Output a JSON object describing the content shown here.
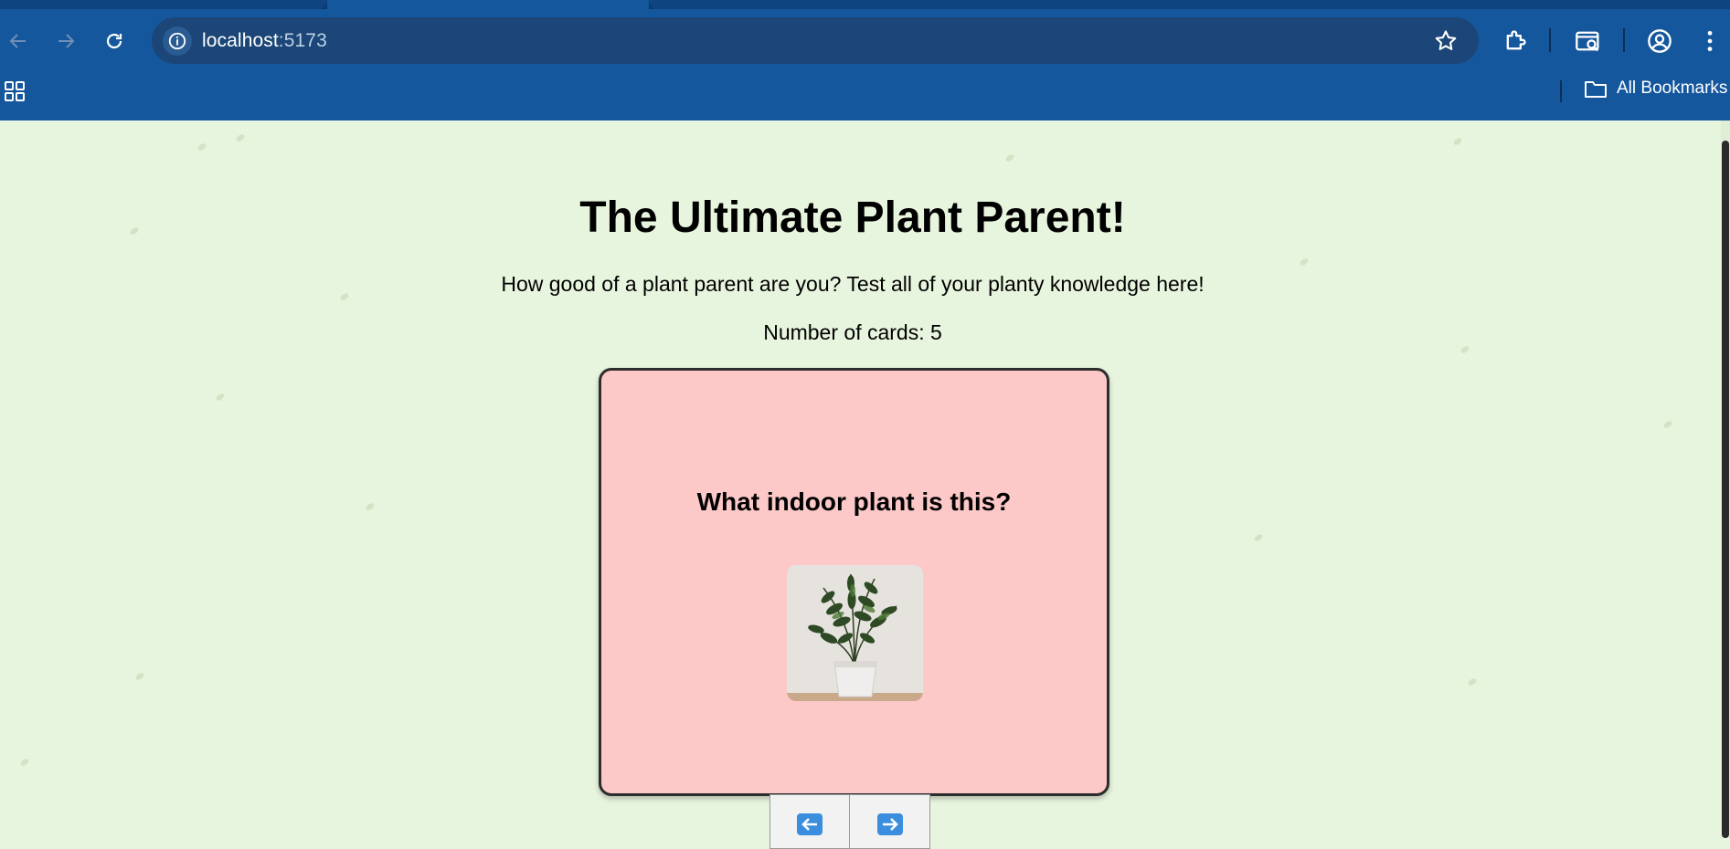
{
  "browser": {
    "url_host": "localhost",
    "url_port": ":5173",
    "bookmarks_label": "All Bookmarks",
    "icons": {
      "back": "arrow-left-icon",
      "forward": "arrow-right-icon",
      "reload": "reload-icon",
      "site_info": "info-icon",
      "bookmark_star": "star-icon",
      "extensions": "puzzle-icon",
      "tab_search": "tab-search-icon",
      "profile": "profile-icon",
      "menu": "kebab-menu-icon",
      "apps": "apps-grid-icon",
      "folder": "folder-icon"
    },
    "colors": {
      "chrome": "#15579d",
      "omnibox": "#1b4677"
    }
  },
  "page": {
    "title": "The Ultimate Plant Parent!",
    "subtitle": "How good of a plant parent are you? Test all of your planty knowledge here!",
    "card_count": "Number of cards: 5",
    "background": "#e8f5de"
  },
  "card": {
    "question": "What indoor plant is this?",
    "background": "#fcc8c8",
    "image_subject": "potted-zz-plant-image"
  },
  "navigation": {
    "prev_icon": "arrow-left-icon",
    "next_icon": "arrow-right-icon"
  }
}
